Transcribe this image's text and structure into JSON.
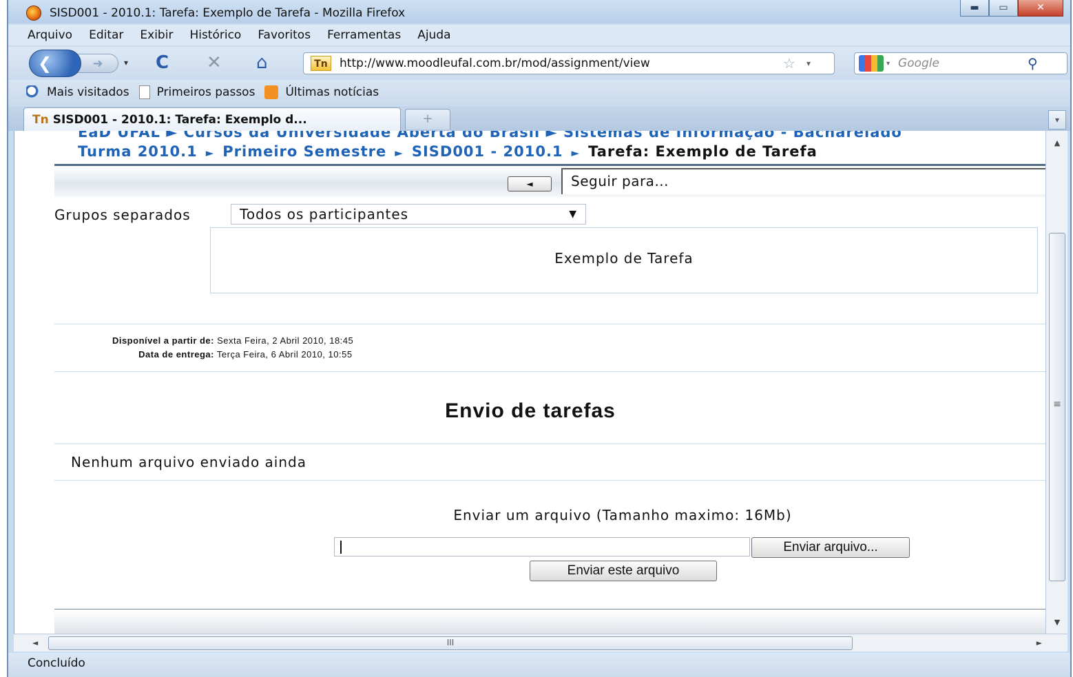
{
  "window": {
    "title": "SISD001 - 2010.1: Tarefa: Exemplo de Tarefa - Mozilla Firefox",
    "minimize_glyph": "▬",
    "maximize_glyph": "▭",
    "close_glyph": "✕"
  },
  "menu": [
    "Arquivo",
    "Editar",
    "Exibir",
    "Histórico",
    "Favoritos",
    "Ferramentas",
    "Ajuda"
  ],
  "navbar": {
    "back_glyph": "❮",
    "forward_glyph": "➜",
    "dropdown_glyph": "▾",
    "reload_glyph": "C",
    "stop_glyph": "✕",
    "home_glyph": "⌂",
    "site_icon_text": "Tn",
    "url": "http://www.moodleufal.com.br/mod/assignment/view",
    "bookmark_star_glyph": "☆",
    "search_placeholder": "Google",
    "search_glyph": "⚲"
  },
  "bookmarks": [
    {
      "label": "Mais visitados",
      "icon": "magnifier-icon"
    },
    {
      "label": "Primeiros passos",
      "icon": "page-icon"
    },
    {
      "label": "Últimas notícias",
      "icon": "rss-icon"
    }
  ],
  "tabs": {
    "active_label": "SISD001 - 2010.1: Tarefa: Exemplo d...",
    "active_icon_text": "Tn",
    "new_tab_glyph": "+",
    "list_glyph": "▾"
  },
  "page": {
    "breadcrumb_clipped": "EaD UFAL ► Cursos da Universidade Aberta do Brasil ► Sistemas de Informação - Bacharelado",
    "breadcrumb": [
      {
        "label": "Turma 2010.1",
        "link": true
      },
      {
        "label": "Primeiro Semestre",
        "link": true
      },
      {
        "label": "SISD001 - 2010.1",
        "link": true
      },
      {
        "label": "Tarefa: Exemplo de Tarefa",
        "link": false
      }
    ],
    "breadcrumb_sep": "►",
    "jump_prev_glyph": "◄",
    "jump_to": "Seguir para...",
    "groups_label": "Grupos separados",
    "groups_selected": "Todos os participantes",
    "groups_arrow": "▼",
    "intro": "Exemplo de Tarefa",
    "available_from_label": "Disponível a partir de:",
    "available_from": "Sexta Feira, 2 Abril 2010, 18:45",
    "due_date_label": "Data de entrega:",
    "due_date": "Terça Feira, 6 Abril 2010, 10:55",
    "submissions_heading": "Envio de tarefas",
    "no_files": "Nenhum arquivo enviado ainda",
    "upload_label": "Enviar um arquivo (Tamanho maximo: 16Mb)",
    "browse_button": "Enviar arquivo...",
    "send_button": "Enviar este arquivo"
  },
  "scrollbars": {
    "up_glyph": "▲",
    "down_glyph": "▼",
    "left_glyph": "◄",
    "right_glyph": "►",
    "v_grip": "≡",
    "h_grip": "III"
  },
  "status": "Concluído"
}
